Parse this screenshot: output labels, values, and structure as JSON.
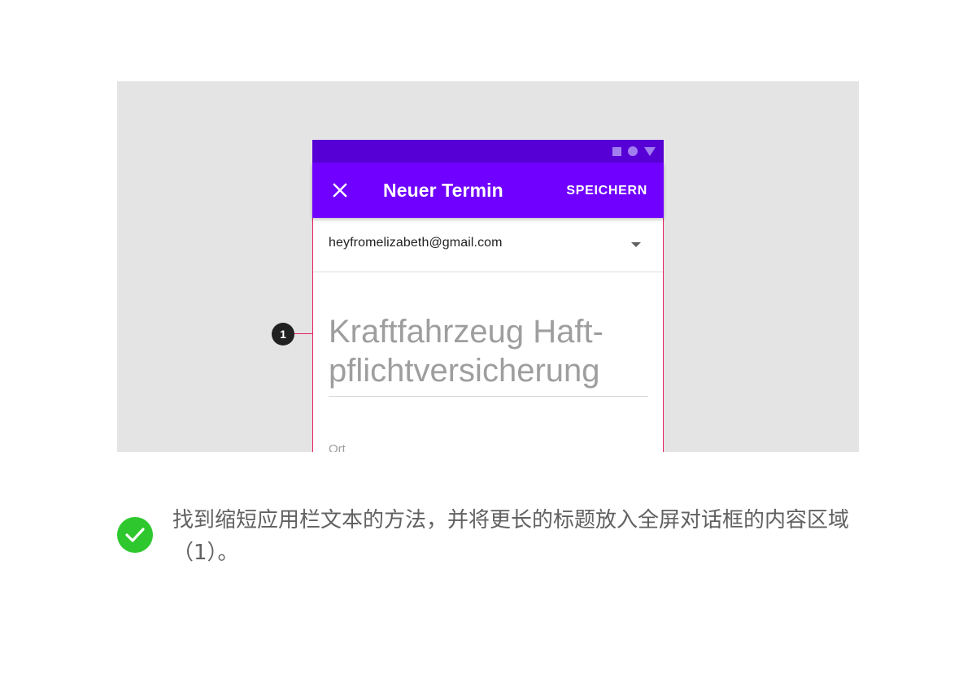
{
  "dialog": {
    "title": "Neuer Termin",
    "save_label": "SPEICHERN",
    "close_icon": "close-icon",
    "status_icons": [
      "square-icon",
      "circle-icon",
      "triangle-icon"
    ]
  },
  "account": {
    "email": "heyfromelizabeth@gmail.com",
    "dropdown_icon": "arrow-drop-down-icon"
  },
  "event": {
    "title_text": "Kraftfahrzeug Haft-\npflichtversicherung",
    "location_label": "Ort"
  },
  "callout": {
    "number": "1"
  },
  "caption": {
    "text": "找到缩短应用栏文本的方法，并将更长的标题放入全屏对话框的内容区域（1）。",
    "status_icon": "check-icon",
    "status_color": "#2ec82e"
  },
  "colors": {
    "status_bar": "#5700d6",
    "app_bar": "#7000ff",
    "callout_line": "#e91e63",
    "stage_background": "#e4e4e4"
  }
}
